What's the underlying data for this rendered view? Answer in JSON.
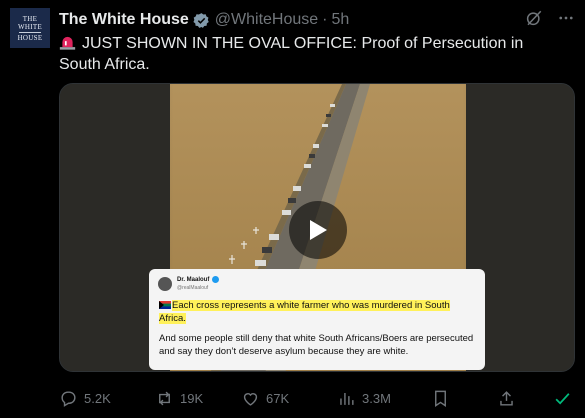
{
  "account": {
    "avatar_line1": "THE",
    "avatar_line2": "WHITE",
    "avatar_line3": "HOUSE",
    "name": "The White House",
    "handle": "@WhiteHouse",
    "separator": "·",
    "time": "5h"
  },
  "tweet": {
    "text": "JUST SHOWN IN THE OVAL OFFICE: Proof of Persecution in South Africa."
  },
  "embedded_card": {
    "author_name": "Dr. Maalouf",
    "author_handle": "@realMaalouf",
    "highlighted_text": "Each cross represents a white farmer who was murdered in South Africa.",
    "body_text": "And some people still deny that white South Africans/Boers are persecuted and say they don’t deserve asylum because they are white."
  },
  "actions": {
    "replies": "5.2K",
    "reposts": "19K",
    "likes": "67K",
    "views": "3.3M"
  },
  "icons": [
    "verified-badge-icon",
    "grok-icon",
    "more-icon",
    "siren-icon",
    "play-icon",
    "reply-icon",
    "repost-icon",
    "like-icon",
    "views-icon",
    "bookmark-icon",
    "share-icon",
    "check-icon"
  ],
  "colors": {
    "background": "#000000",
    "text": "#e7e9ea",
    "muted": "#71767b",
    "accent": "#1d9bf0",
    "highlight": "#fff15a",
    "check": "#00ba7c"
  }
}
